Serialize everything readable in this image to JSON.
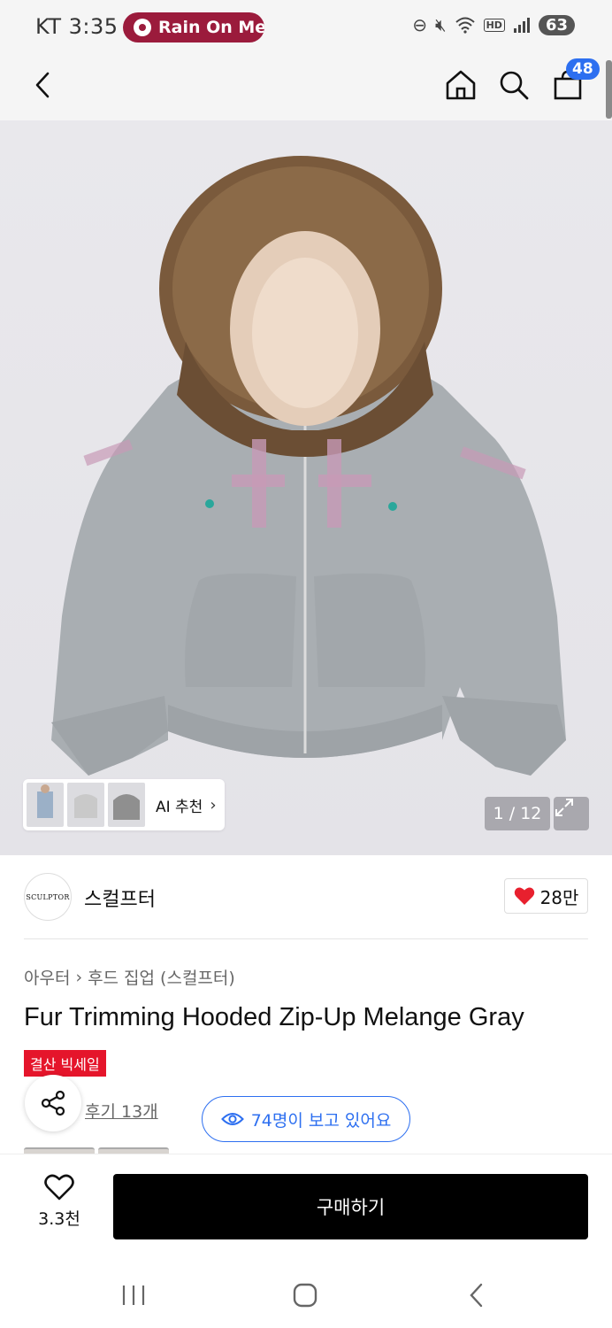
{
  "status_bar": {
    "carrier_time": "KT 3:35",
    "media_title": "Rain On Me",
    "battery": "63",
    "hd_label": "HD"
  },
  "app_bar": {
    "cart_count": "48"
  },
  "gallery": {
    "ai_label": "AI 추천",
    "page_indicator": "1 / 12"
  },
  "brand": {
    "logo_text": "SCULPTOR",
    "name": "스컬프터",
    "likes": "28만"
  },
  "product": {
    "breadcrumb": [
      "아우터",
      "후드 집업 (스컬프터)"
    ],
    "title": "Fur Trimming Hooded Zip-Up Melange Gray",
    "sale_badge": "결산 빅세일",
    "review_link": "후기 13개",
    "viewers": "74명이 보고 있어요"
  },
  "bottom_bar": {
    "wish_count": "3.3천",
    "buy_label": "구매하기"
  },
  "colors": {
    "accent_blue": "#2d6ff0",
    "sale_red": "#e5152b",
    "media_pill": "#9b1b3c",
    "heart_red": "#e8202e"
  }
}
